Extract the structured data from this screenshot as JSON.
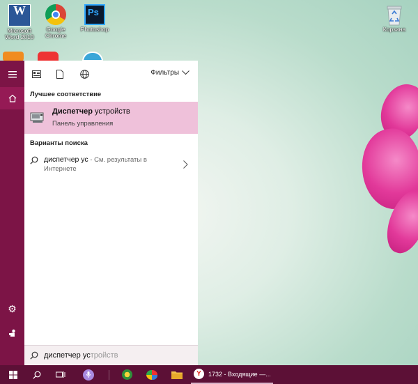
{
  "desktop": {
    "icons": [
      {
        "label": "Microsoft Word 2010",
        "icon": "word-icon"
      },
      {
        "label": "Google Chrome",
        "icon": "chrome-icon"
      },
      {
        "label": "Photoshop",
        "icon": "photoshop-icon"
      },
      {
        "label": "Корзина",
        "icon": "recycle-bin-icon"
      }
    ],
    "photoshop_tile": "Ps",
    "word_tile": "W"
  },
  "start_menu": {
    "toolbar": {
      "filters_label": "Фильтры"
    },
    "best_match_header": "Лучшее соответствие",
    "best_match": {
      "title_bold": "Диспетчер",
      "title_rest": " устройств",
      "subtitle": "Панель управления"
    },
    "suggestions_header": "Варианты поиска",
    "suggestion": {
      "query": "диспетчер ус",
      "hint_line1": " - См. результаты в",
      "hint_line2": "Интернете"
    },
    "search": {
      "typed": "диспетчер ус",
      "completion": "тройств"
    }
  },
  "taskbar": {
    "active_window_label": "1732 - Входящие —...",
    "active_window_icon_letter": "Y"
  },
  "colors": {
    "accent": "#7c1446",
    "highlight": "#efc1da",
    "taskbar": "#5c1036"
  }
}
